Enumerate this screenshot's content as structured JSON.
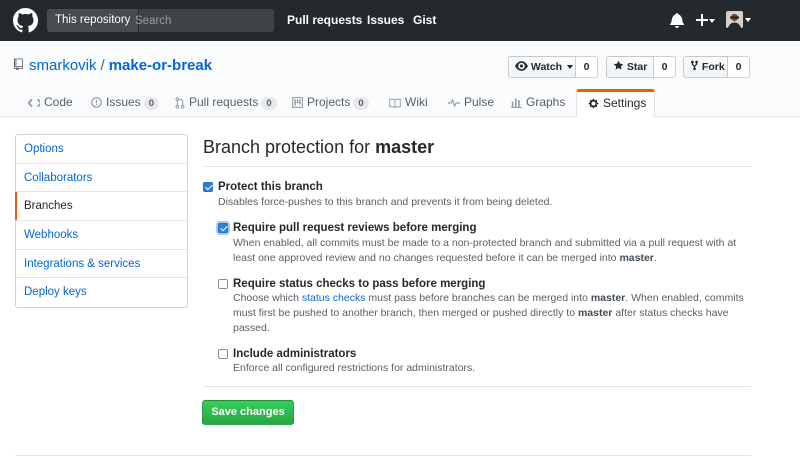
{
  "header": {
    "search_scope": "This repository",
    "search_placeholder": "Search",
    "nav": [
      "Pull requests",
      "Issues",
      "Gist"
    ],
    "icons": [
      "github-logo-icon",
      "bell-icon",
      "plus-icon",
      "avatar"
    ]
  },
  "repo": {
    "owner": "smarkovik",
    "separator": "/",
    "name": "make-or-break",
    "watch_label": "Watch",
    "watch_count": "0",
    "star_label": "Star",
    "star_count": "0",
    "fork_label": "Fork",
    "fork_count": "0"
  },
  "tabs": [
    {
      "label": "Code",
      "icon": "code-icon"
    },
    {
      "label": "Issues",
      "icon": "issue-icon",
      "count": "0"
    },
    {
      "label": "Pull requests",
      "icon": "pull-request-icon",
      "count": "0"
    },
    {
      "label": "Projects",
      "icon": "project-icon",
      "count": "0"
    },
    {
      "label": "Wiki",
      "icon": "wiki-icon"
    },
    {
      "label": "Pulse",
      "icon": "pulse-icon"
    },
    {
      "label": "Graphs",
      "icon": "graph-icon"
    },
    {
      "label": "Settings",
      "icon": "gear-icon",
      "selected": true
    }
  ],
  "sidebar": {
    "items": [
      {
        "label": "Options"
      },
      {
        "label": "Collaborators"
      },
      {
        "label": "Branches",
        "selected": true
      },
      {
        "label": "Webhooks"
      },
      {
        "label": "Integrations & services"
      },
      {
        "label": "Deploy keys"
      }
    ]
  },
  "main": {
    "title_prefix": "Branch protection for",
    "title_branch": "master",
    "protect": {
      "label": "Protect this branch",
      "checked": true,
      "note": "Disables force-pushes to this branch and prevents it from being deleted."
    },
    "reviews": {
      "label": "Require pull request reviews before merging",
      "checked": true,
      "note_1": "When enabled, all commits must be made to a non-protected branch and submitted via a pull request with at",
      "note_2": "least one approved review and no changes requested before it can be merged into",
      "note_2_branch": "master",
      "note_2_end": "."
    },
    "status": {
      "label": "Require status checks to pass before merging",
      "checked": false,
      "note_1a": "Choose which",
      "note_1_link": "status checks",
      "note_1b": "must pass before branches can be merged into",
      "note_1_branch": "master",
      "note_1c": ". When enabled, commits",
      "note_2a": "must first be pushed to another branch, then merged or pushed directly to",
      "note_2_branch": "master",
      "note_2b": "after status checks have",
      "note_3": "passed."
    },
    "admins": {
      "label": "Include administrators",
      "checked": false,
      "note": "Enforce all configured restrictions for administrators."
    },
    "save_label": "Save changes"
  },
  "colors": {
    "header_bg": "#24292e",
    "link": "#0366d6",
    "accent": "#e36209",
    "primary_button": "#28a745"
  }
}
